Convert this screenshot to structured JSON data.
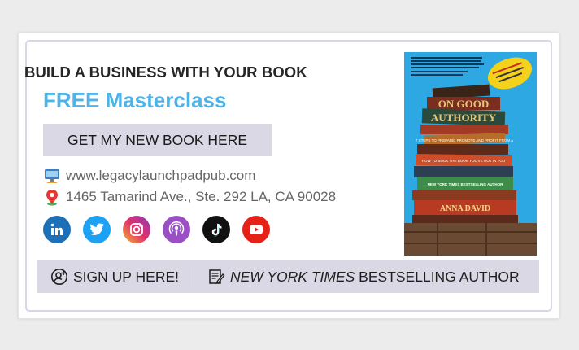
{
  "headline": "BUILD A BUSINESS WITH YOUR BOOK",
  "subheadline": "FREE Masterclass",
  "book_button": "GET MY NEW BOOK HERE",
  "website": "www.legacylaunchpadpub.com",
  "address": "1465 Tamarind Ave., Ste. 292 LA, CA 90028",
  "social": [
    {
      "name": "linkedin-icon",
      "color": "#1d6fb8"
    },
    {
      "name": "twitter-icon",
      "color": "#1da1f2"
    },
    {
      "name": "instagram-icon",
      "color": "#d6297a"
    },
    {
      "name": "podcast-icon",
      "color": "#9a4fc4"
    },
    {
      "name": "tiktok-icon",
      "color": "#111111"
    },
    {
      "name": "youtube-icon",
      "color": "#e62117"
    }
  ],
  "cover": {
    "title_line1": "ON GOOD",
    "title_line2": "AUTHORITY",
    "subtitle": "7 STEPS TO PREPARE, PROMOTE AND PROFIT FROM A",
    "subtitle2": "HOW TO BOOK THE BOOK YOU'VE GOT IN YOU",
    "badge": "NEW YORK TIMES BESTSELLING AUTHOR",
    "author": "ANNA DAVID"
  },
  "bottom": {
    "signup": "SIGN UP HERE!",
    "nyt_italic": "NEW YORK TIMES",
    "nyt_rest": " BESTSELLING AUTHOR"
  }
}
